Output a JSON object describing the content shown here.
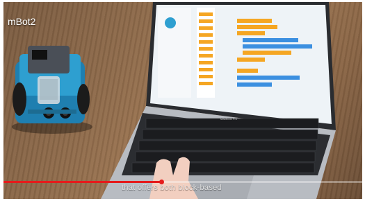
{
  "video": {
    "title": "mBot2",
    "subtitle": "that offers both block-based",
    "progress": 0.44
  },
  "laptop": {
    "brand_label": "MacBook Pro"
  },
  "colors": {
    "accent": "#e51b1b",
    "ide_bg": "#eef3f7",
    "block_orange": "#f5a623",
    "block_blue": "#3b8fe0",
    "robot_body": "#2e9fd0"
  },
  "icons": [
    "play-bar",
    "robot",
    "keyboard"
  ]
}
